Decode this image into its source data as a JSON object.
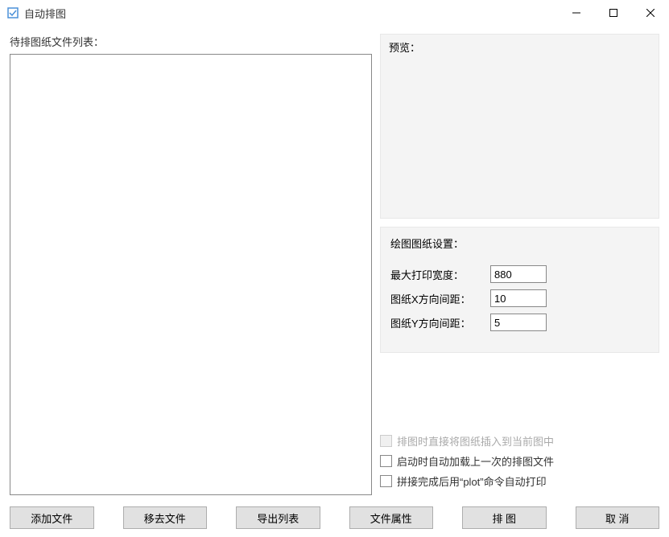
{
  "window": {
    "title": "自动排图"
  },
  "left": {
    "label": "待排图纸文件列表："
  },
  "preview": {
    "label": "预览："
  },
  "settings": {
    "title": "绘图图纸设置：",
    "max_print_width_label": "最大打印宽度：",
    "max_print_width_value": "880",
    "x_spacing_label": "图纸X方向间距：",
    "x_spacing_value": "10",
    "y_spacing_label": "图纸Y方向间距：",
    "y_spacing_value": "5"
  },
  "checkboxes": {
    "insert_current_label": "排图时直接将图纸插入到当前图中",
    "load_last_label": "启动时自动加载上一次的排图文件",
    "auto_plot_label": "拼接完成后用“plot”命令自动打印"
  },
  "buttons": {
    "add_file": "添加文件",
    "remove_file": "移去文件",
    "export_list": "导出列表",
    "file_props": "文件属性",
    "arrange": "排  图",
    "cancel": "取  消"
  }
}
